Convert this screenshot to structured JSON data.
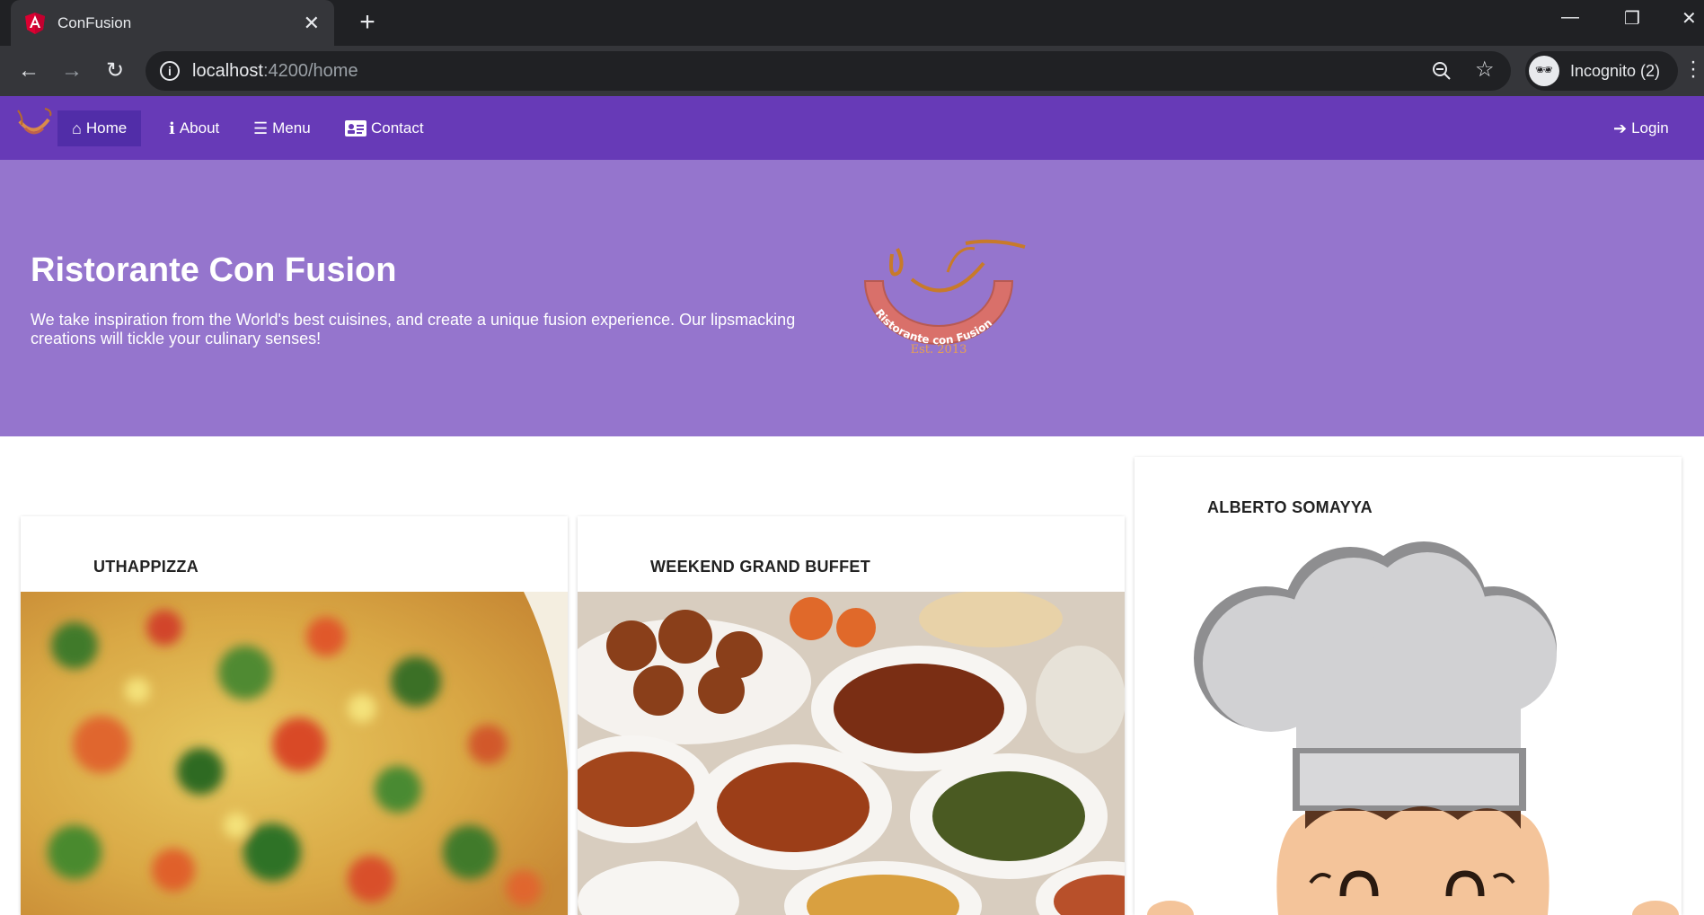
{
  "browser": {
    "tab_title": "ConFusion",
    "url_host": "localhost",
    "url_path": ":4200/home",
    "profile_label": "Incognito (2)"
  },
  "navbar": {
    "items": [
      {
        "label": "Home",
        "icon": "home-icon"
      },
      {
        "label": "About",
        "icon": "info-icon"
      },
      {
        "label": "Menu",
        "icon": "list-icon"
      },
      {
        "label": "Contact",
        "icon": "address-card-icon"
      }
    ],
    "login_label": "Login"
  },
  "jumbotron": {
    "title": "Ristorante Con Fusion",
    "text": "We take inspiration from the World's best cuisines, and create a unique fusion experience. Our lipsmacking creations will tickle your culinary senses!",
    "logo_text": "Ristorante con Fusion",
    "logo_est": "Est. 2013"
  },
  "cards": [
    {
      "title": "UTHAPPIZZA",
      "image": "pizza-image"
    },
    {
      "title": "WEEKEND GRAND BUFFET",
      "image": "buffet-image"
    },
    {
      "title": "ALBERTO SOMAYYA",
      "image": "chef-image"
    }
  ],
  "colors": {
    "primary": "#673ab7",
    "primary_dark": "#512da8",
    "primary_light": "#9575cd"
  }
}
